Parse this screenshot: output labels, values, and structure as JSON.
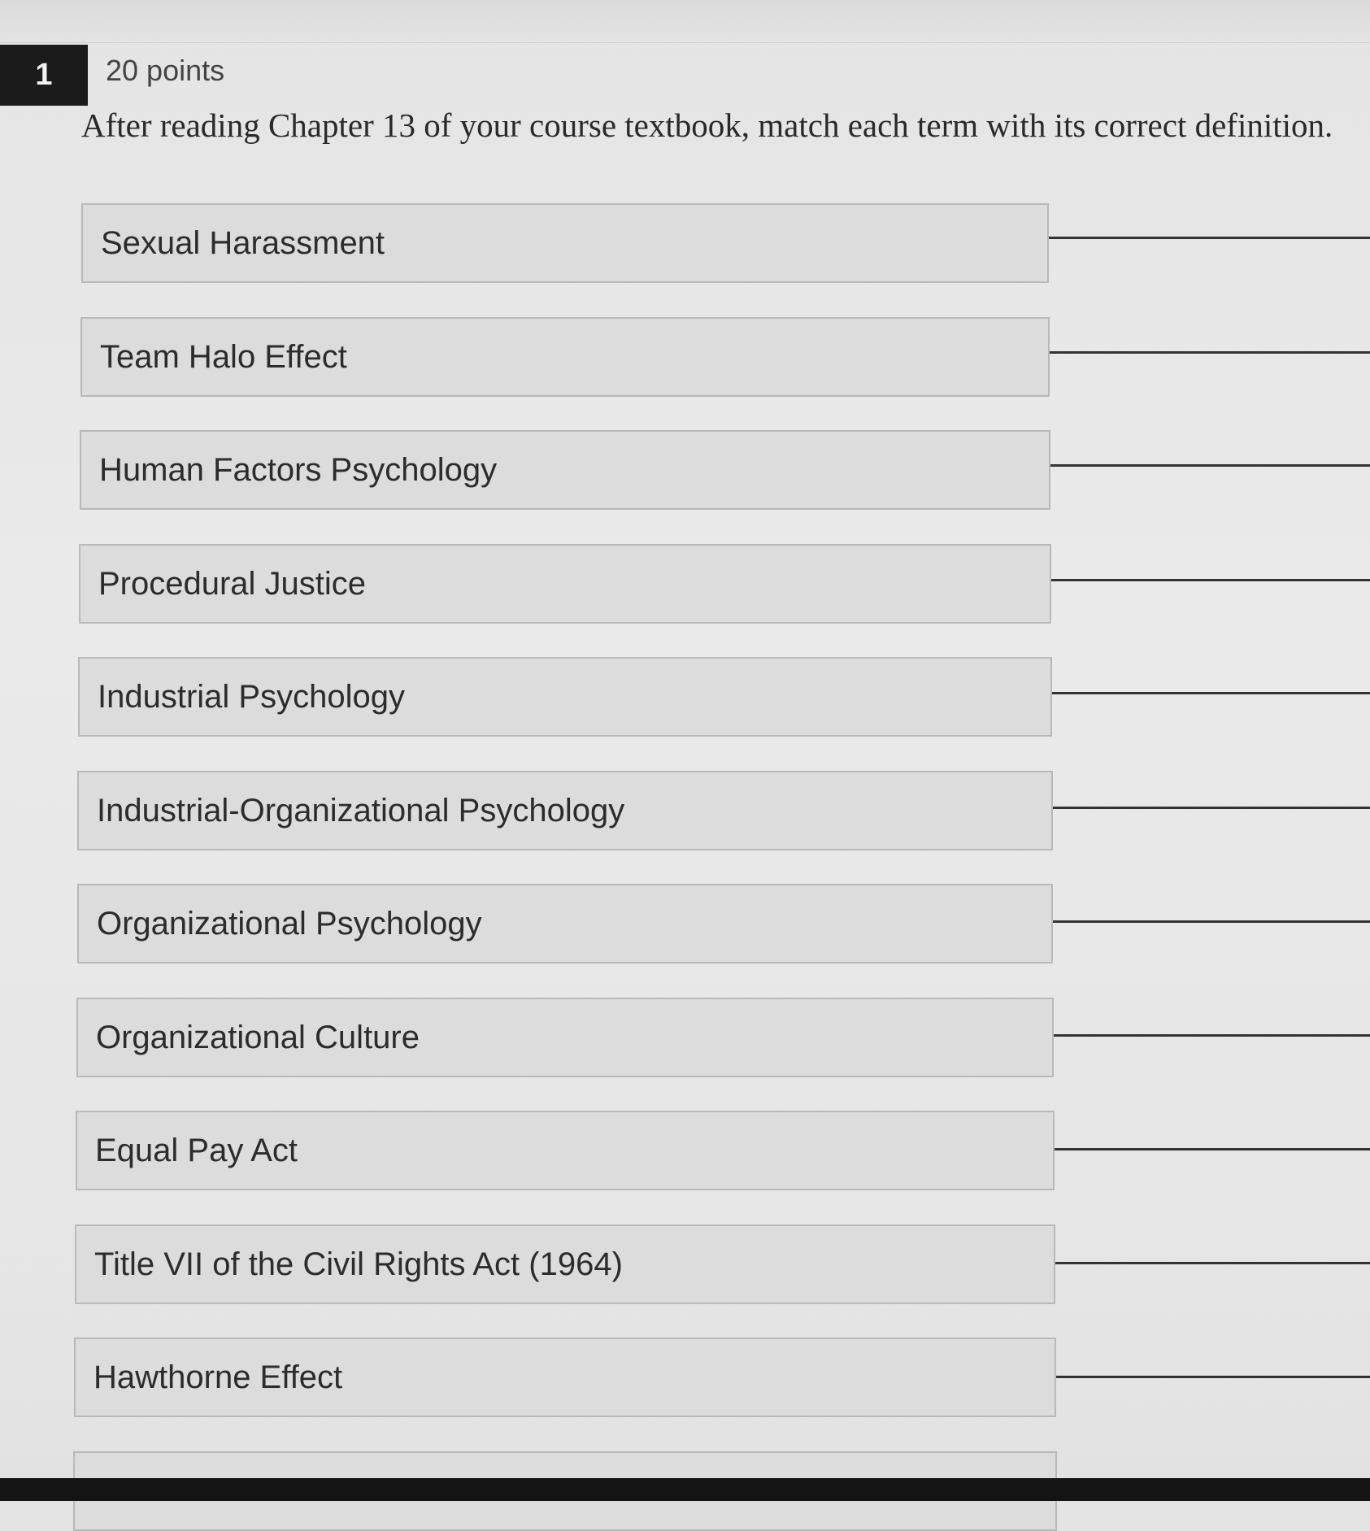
{
  "question": {
    "number": "1",
    "points": "20 points",
    "prompt": "After reading Chapter 13 of your course textbook, match each term with its correct definition."
  },
  "terms": [
    {
      "label": "Sexual Harassment"
    },
    {
      "label": "Team Halo Effect"
    },
    {
      "label": "Human Factors Psychology"
    },
    {
      "label": "Procedural Justice"
    },
    {
      "label": "Industrial Psychology"
    },
    {
      "label": "Industrial-Organizational Psychology"
    },
    {
      "label": "Organizational Psychology"
    },
    {
      "label": "Organizational Culture"
    },
    {
      "label": "Equal Pay Act"
    },
    {
      "label": "Title VII of the Civil Rights Act (1964)"
    },
    {
      "label": "Hawthorne Effect"
    },
    {
      "label": ""
    }
  ],
  "colors": {
    "question_badge_bg": "#1b1b1b",
    "term_box_bg": "#dcdcdc",
    "term_box_border": "#b9b9b9",
    "answer_line": "#333333"
  }
}
